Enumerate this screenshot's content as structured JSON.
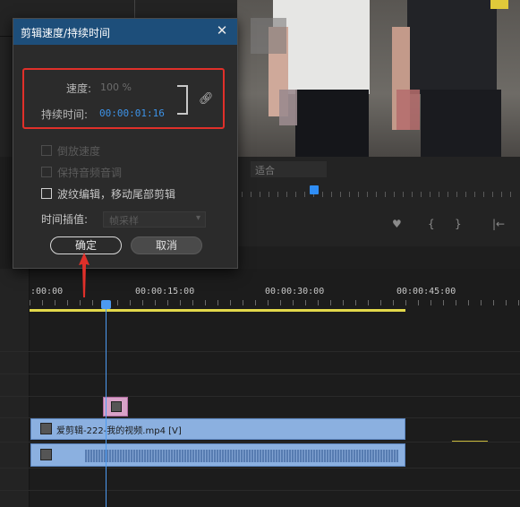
{
  "dialog": {
    "title": "剪辑速度/持续时间",
    "speed_label": "速度:",
    "speed_value": "100 %",
    "duration_label": "持续时间:",
    "duration_value": "00:00:01:16",
    "reverse_label": "倒放速度",
    "keep_pitch_label": "保持音频音调",
    "ripple_label": "波纹编辑，移动尾部剪辑",
    "interp_label": "时间插值:",
    "interp_value": "帧采样",
    "ok_label": "确定",
    "cancel_label": "取消"
  },
  "timeline": {
    "ticks": [
      ":00:00",
      "00:00:15:00",
      "00:00:30:00",
      "00:00:45:00"
    ],
    "clip_name": "爱剪辑-222-我的视频.mp4 [V]"
  },
  "monitor": {
    "fit_value": "适合"
  },
  "colors": {
    "accent": "#3d93e8",
    "title_bar": "#1d4e7a",
    "highlight": "#e0302a",
    "clip": "#8bb0e0",
    "work_area": "#e2d84a"
  }
}
